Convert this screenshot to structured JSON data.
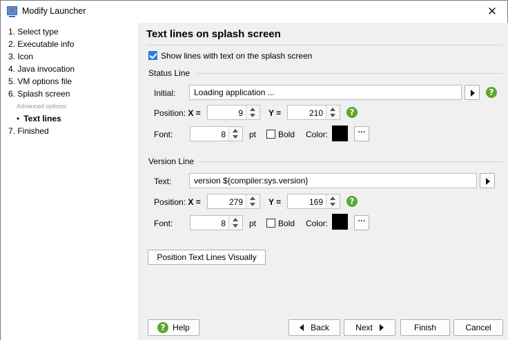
{
  "window": {
    "title": "Modify Launcher",
    "close_glyph": "✕"
  },
  "sidebar": {
    "steps": [
      {
        "label": "1. Select type"
      },
      {
        "label": "2. Executable info"
      },
      {
        "label": "3. Icon"
      },
      {
        "label": "4. Java invocation"
      },
      {
        "label": "5. VM options file"
      },
      {
        "label": "6. Splash screen"
      },
      {
        "label": "Advanced options:"
      },
      {
        "label": "Text lines"
      },
      {
        "label": "7. Finished"
      }
    ],
    "bullet": "•"
  },
  "main": {
    "title": "Text lines on splash screen",
    "show_lines": {
      "label": "Show lines with text on the splash screen",
      "checked": true
    },
    "status_line": {
      "group_label": "Status Line",
      "initial_label": "Initial:",
      "initial_value": "Loading application ...",
      "position_label": "Position:",
      "x_label": "X =",
      "x_value": "9",
      "y_label": "Y =",
      "y_value": "210",
      "font_label": "Font:",
      "font_value": "8",
      "pt_label": "pt",
      "bold_label": "Bold",
      "bold_checked": false,
      "color_label": "Color:",
      "color_value": "#000000",
      "more_glyph": "···"
    },
    "version_line": {
      "group_label": "Version Line",
      "text_label": "Text:",
      "text_value": "version ${compiler:sys.version}",
      "position_label": "Position:",
      "x_label": "X =",
      "x_value": "279",
      "y_label": "Y =",
      "y_value": "169",
      "font_label": "Font:",
      "font_value": "8",
      "pt_label": "pt",
      "bold_label": "Bold",
      "bold_checked": false,
      "color_label": "Color:",
      "color_value": "#000000",
      "more_glyph": "···"
    },
    "position_visually_button": "Position Text Lines Visually",
    "help_glyph": "?"
  },
  "footer": {
    "help": "Help",
    "back": "Back",
    "next": "Next",
    "finish": "Finish",
    "cancel": "Cancel"
  },
  "colors": {
    "accent": "#2a7de1",
    "help_green": "#5da630",
    "panel_bg": "#f0f0f0"
  }
}
